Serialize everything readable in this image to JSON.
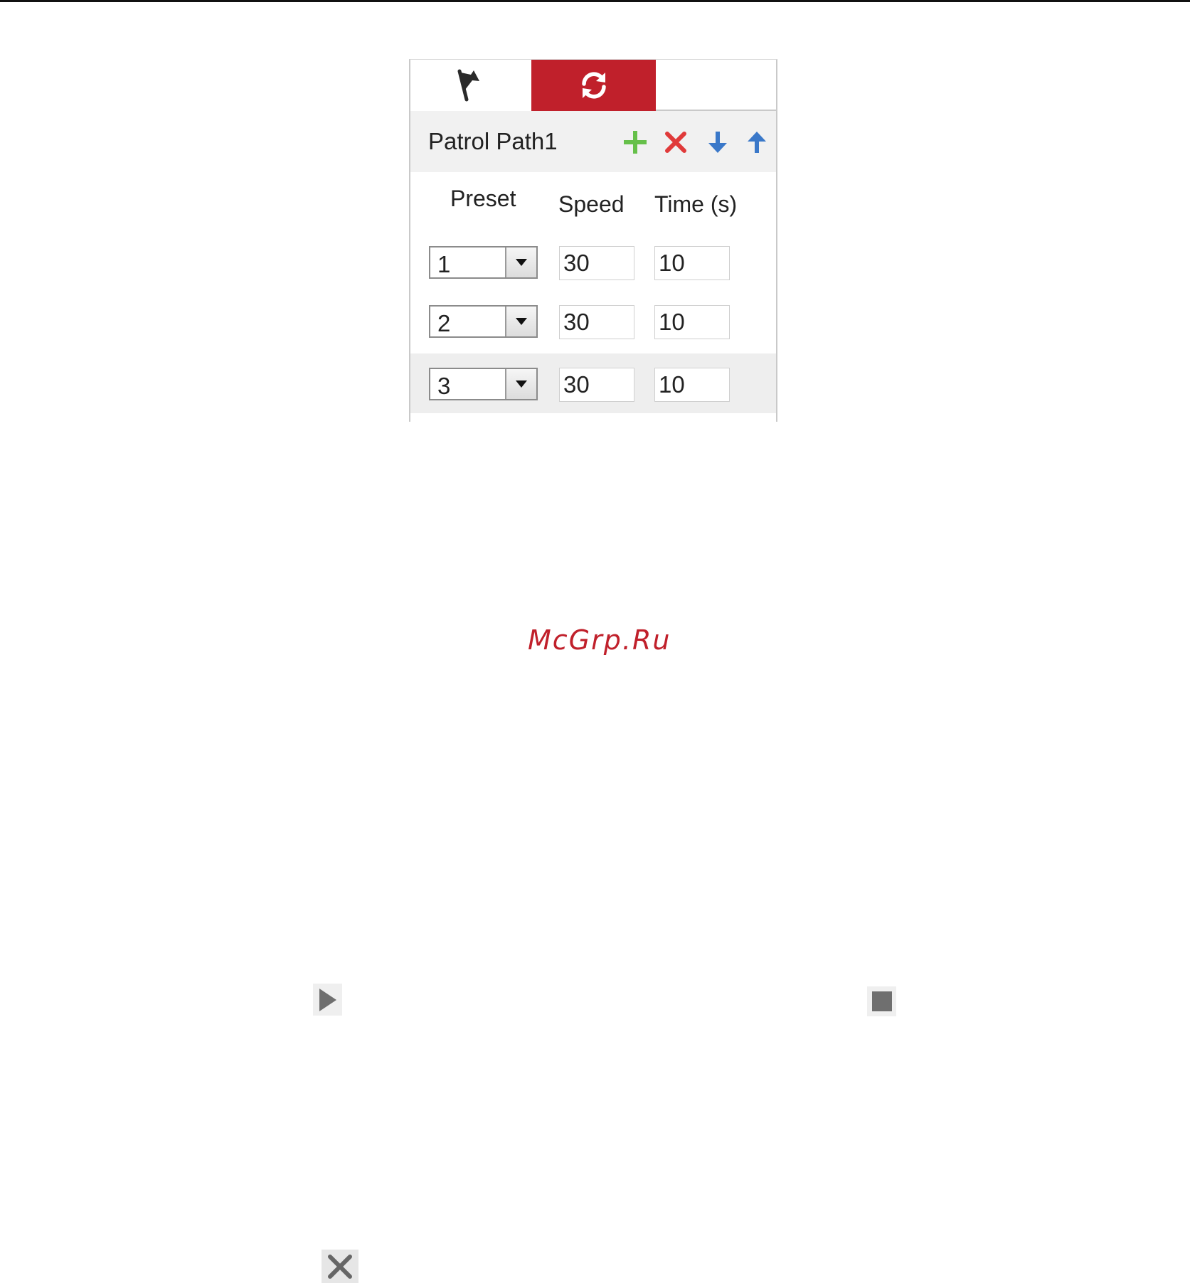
{
  "patrol_panel": {
    "tabs": [
      {
        "icon": "flag-icon",
        "active": false
      },
      {
        "icon": "refresh-icon",
        "active": true
      }
    ],
    "path_name": "Patrol Path1",
    "toolbar_icons": [
      "add-icon",
      "delete-icon",
      "move-down-icon",
      "move-up-icon"
    ],
    "columns": {
      "preset": "Preset",
      "speed": "Speed",
      "time": "Time (s)"
    },
    "rows": [
      {
        "preset": "1",
        "speed": "30",
        "time": "10"
      },
      {
        "preset": "2",
        "speed": "30",
        "time": "10"
      },
      {
        "preset": "3",
        "speed": "30",
        "time": "10"
      }
    ]
  },
  "watermark": "McGrp.Ru",
  "standalone_icons": [
    "play-icon",
    "stop-icon",
    "close-icon"
  ],
  "colors": {
    "accent": "#c0202b",
    "add": "#66c04a",
    "delete": "#e03a3a",
    "move": "#3a78c9"
  }
}
